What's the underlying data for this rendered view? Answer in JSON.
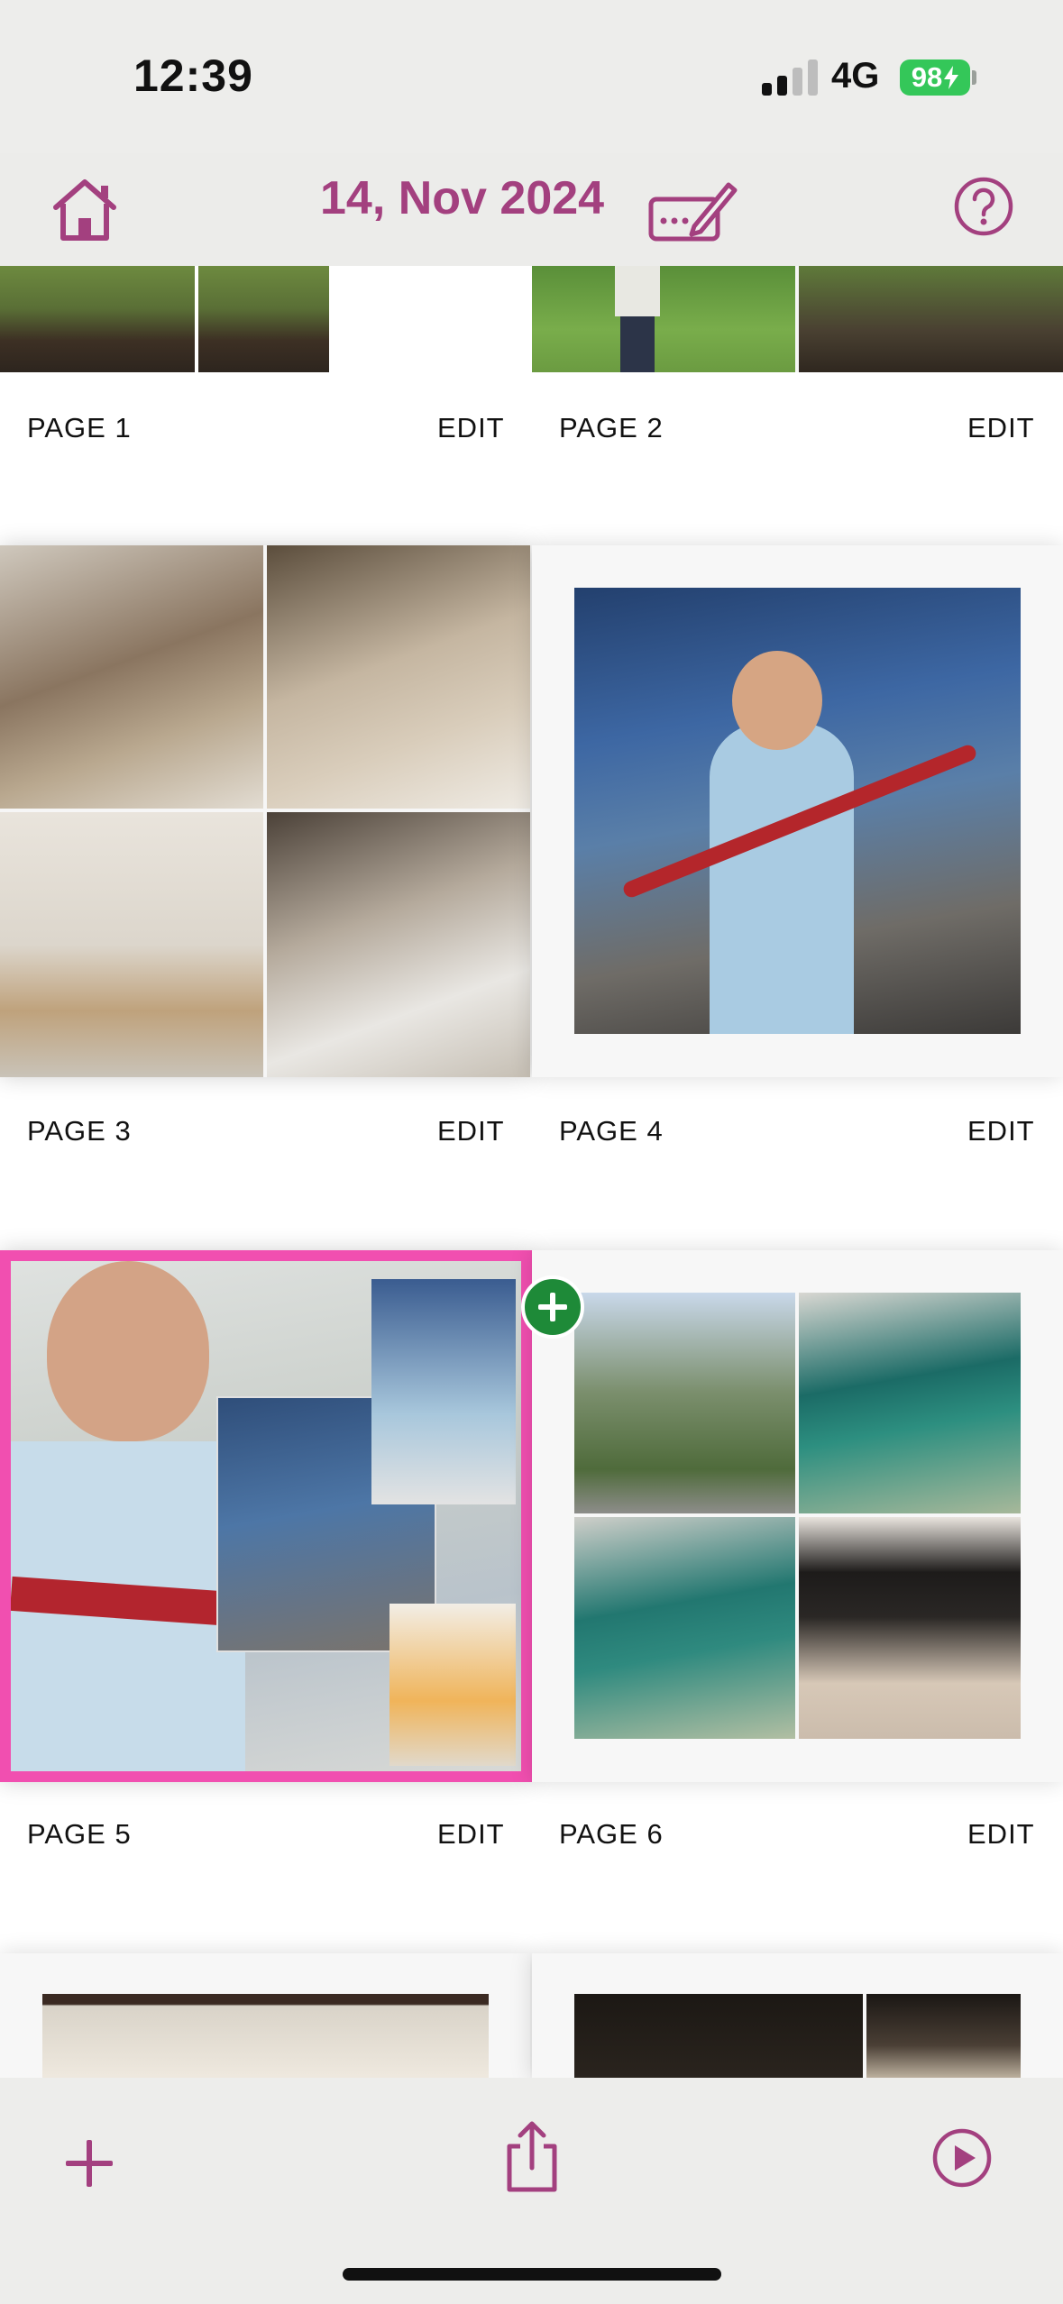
{
  "status_bar": {
    "time": "12:39",
    "network": "4G",
    "battery": "98"
  },
  "header": {
    "date_title": "14, Nov 2024",
    "home_icon": "home-icon",
    "edit_title_icon": "edit-pencil-icon",
    "help_icon": "help-icon",
    "accent_color": "#a3407f"
  },
  "pages": [
    {
      "label": "PAGE 1",
      "edit": "EDIT"
    },
    {
      "label": "PAGE 2",
      "edit": "EDIT"
    },
    {
      "label": "PAGE 3",
      "edit": "EDIT"
    },
    {
      "label": "PAGE 4",
      "edit": "EDIT"
    },
    {
      "label": "PAGE 5",
      "edit": "EDIT"
    },
    {
      "label": "PAGE 6",
      "edit": "EDIT"
    }
  ],
  "toolbar": {
    "add_icon": "plus-icon",
    "share_icon": "share-icon",
    "play_icon": "play-icon"
  },
  "colors": {
    "selection": "#f14fb0",
    "insert": "#1e8a38",
    "accent": "#a3407f"
  }
}
